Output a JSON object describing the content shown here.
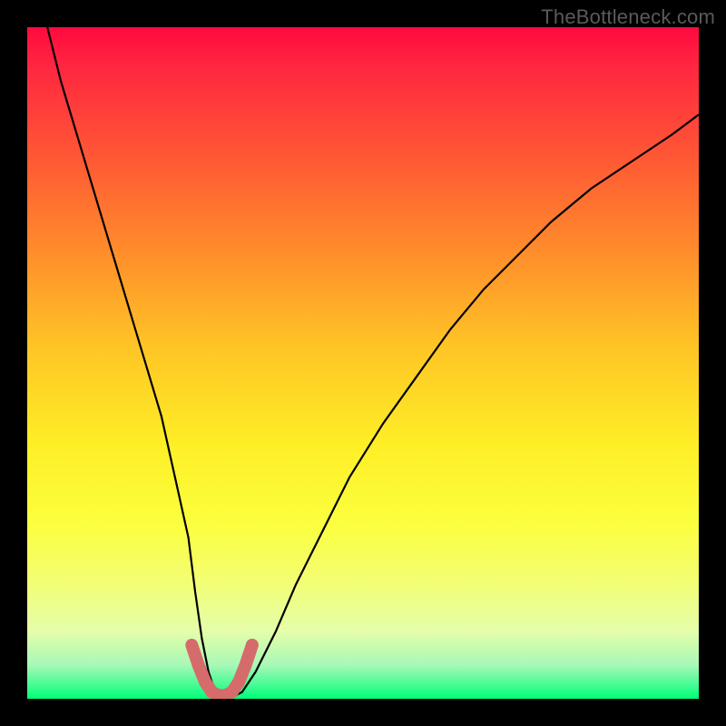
{
  "watermark": "TheBottleneck.com",
  "chart_data": {
    "type": "line",
    "title": "",
    "xlabel": "",
    "ylabel": "",
    "xlim": [
      0,
      100
    ],
    "ylim": [
      0,
      100
    ],
    "grid": false,
    "legend": false,
    "background": "rainbow-vertical-gradient",
    "series": [
      {
        "name": "bottleneck-curve",
        "color": "#000000",
        "x": [
          3,
          5,
          8,
          11,
          14,
          17,
          20,
          22,
          24,
          25,
          26,
          27,
          28,
          30,
          32,
          34,
          37,
          40,
          44,
          48,
          53,
          58,
          63,
          68,
          73,
          78,
          84,
          90,
          96,
          100
        ],
        "values": [
          100,
          92,
          82,
          72,
          62,
          52,
          42,
          33,
          24,
          16,
          9,
          4,
          1,
          0,
          1,
          4,
          10,
          17,
          25,
          33,
          41,
          48,
          55,
          61,
          66,
          71,
          76,
          80,
          84,
          87
        ]
      },
      {
        "name": "valley-highlight",
        "color": "#d66b6b",
        "x": [
          24.5,
          25.5,
          26.5,
          27.5,
          28.5,
          29.5,
          30.5,
          31.5,
          32.5,
          33.5
        ],
        "values": [
          8,
          5,
          2.5,
          1,
          0.5,
          0.5,
          1,
          2.5,
          5,
          8
        ]
      }
    ]
  },
  "colors": {
    "frame": "#000000",
    "curve": "#000000",
    "highlight": "#d66b6b",
    "gradient_stops": [
      "#ff0a3f",
      "#ff5a34",
      "#ffc626",
      "#fbff3e",
      "#00ff7a"
    ]
  }
}
